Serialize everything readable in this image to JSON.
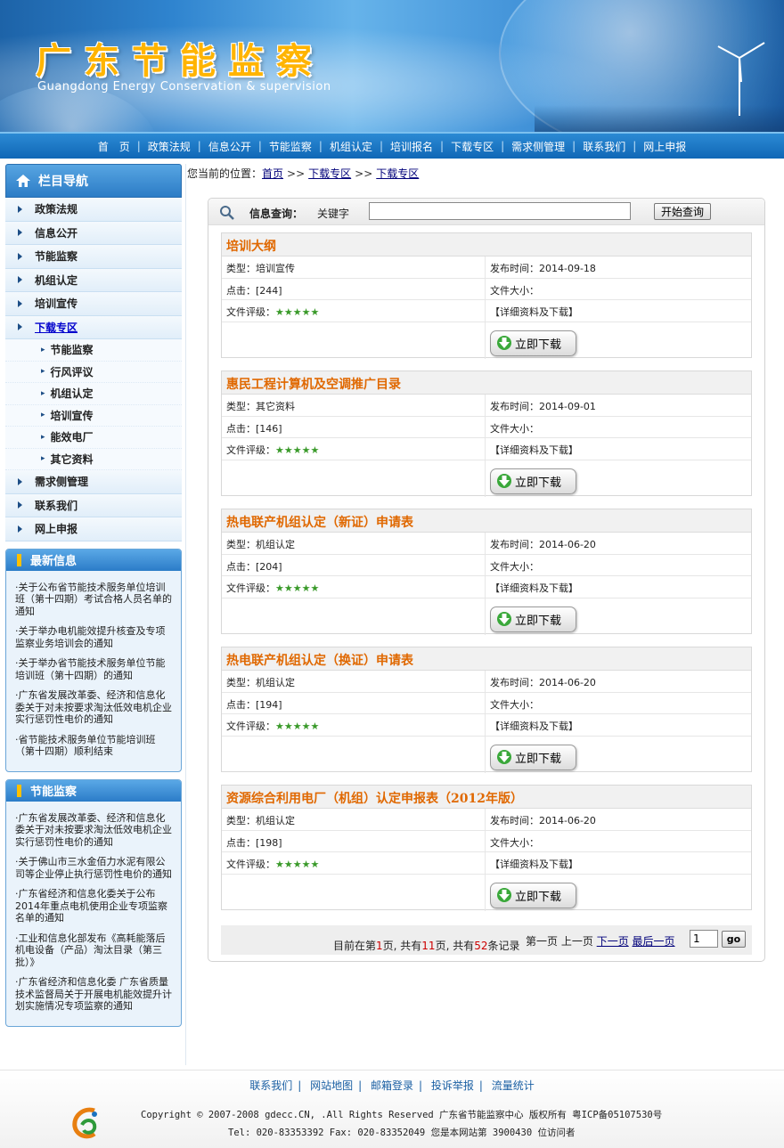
{
  "header": {
    "site_title": "广东节能监察",
    "site_subtitle": "Guangdong Energy Conservation & supervision"
  },
  "nav": [
    {
      "label": "首　页"
    },
    {
      "label": "政策法规"
    },
    {
      "label": "信息公开"
    },
    {
      "label": "节能监察"
    },
    {
      "label": "机组认定"
    },
    {
      "label": "培训报名"
    },
    {
      "label": "下载专区"
    },
    {
      "label": "需求侧管理"
    },
    {
      "label": "联系我们"
    },
    {
      "label": "网上申报"
    }
  ],
  "sidebar": {
    "title": "栏目导航",
    "items": [
      {
        "label": "政策法规"
      },
      {
        "label": "信息公开"
      },
      {
        "label": "节能监察"
      },
      {
        "label": "机组认定"
      },
      {
        "label": "培训宣传"
      },
      {
        "label": "下载专区"
      }
    ],
    "subitems": [
      {
        "label": "节能监察"
      },
      {
        "label": "行风评议"
      },
      {
        "label": "机组认定"
      },
      {
        "label": "培训宣传"
      },
      {
        "label": "能效电厂"
      },
      {
        "label": "其它资料"
      }
    ],
    "items_after": [
      {
        "label": "需求侧管理"
      },
      {
        "label": "联系我们"
      },
      {
        "label": "网上申报"
      }
    ]
  },
  "latest_news": {
    "title": "最新信息",
    "items": [
      "·关于公布省节能技术服务单位培训班（第十四期）考试合格人员名单的通知",
      "·关于举办电机能效提升核查及专项监察业务培训会的通知",
      "·关于举办省节能技术服务单位节能培训班（第十四期）的通知",
      "·广东省发展改革委、经济和信息化委关于对未按要求淘汰低效电机企业实行惩罚性电价的通知",
      "·省节能技术服务单位节能培训班（第十四期）顺利结束"
    ]
  },
  "supervision_news": {
    "title": "节能监察",
    "items": [
      "·广东省发展改革委、经济和信息化委关于对未按要求淘汰低效电机企业实行惩罚性电价的通知",
      "·关于佛山市三水金佰力水泥有限公司等企业停止执行惩罚性电价的通知",
      "·广东省经济和信息化委关于公布2014年重点电机使用企业专项监察名单的通知",
      "·工业和信息化部发布《高耗能落后机电设备（产品）淘汰目录（第三批）》",
      "·广东省经济和信息化委 广东省质量技术监督局关于开展电机能效提升计划实施情况专项监察的通知"
    ]
  },
  "breadcrumb": {
    "prefix": "您当前的位置：",
    "links": [
      "首页",
      "下载专区",
      "下载专区"
    ],
    "sep": ">>"
  },
  "search": {
    "label": "信息查询：",
    "keyword_label": "关键字",
    "value": "",
    "button": "开始查询"
  },
  "labels": {
    "type": "类型：",
    "hits": "点击：",
    "rating": "文件评级：",
    "date": "发布时间：",
    "size": "文件大小：",
    "detail": "【详细资料及下载】",
    "download": "立即下载"
  },
  "files": [
    {
      "title": "培训大纲",
      "type": "培训宣传",
      "hits": "[244]",
      "date": "2014-09-18",
      "stars": "★★★★★",
      "rating": 5
    },
    {
      "title": "惠民工程计算机及空调推广目录",
      "type": "其它资料",
      "hits": "[146]",
      "date": "2014-09-01",
      "stars": "★★★★★",
      "rating": 5
    },
    {
      "title": "热电联产机组认定（新证）申请表",
      "type": "机组认定",
      "hits": "[204]",
      "date": "2014-06-20",
      "stars": "★★★★★",
      "rating": 5
    },
    {
      "title": "热电联产机组认定（换证）申请表",
      "type": "机组认定",
      "hits": "[194]",
      "date": "2014-06-20",
      "stars": "★★★★★",
      "rating": 5
    },
    {
      "title": "资源综合利用电厂（机组）认定申报表（2012年版）",
      "type": "机组认定",
      "hits": "[198]",
      "date": "2014-06-20",
      "stars": "★★★★★",
      "rating": 5
    }
  ],
  "pager": {
    "t1": "目前在第",
    "current": "1",
    "t2": "页, 共有",
    "total_pages": "11",
    "t3": "页, 共有",
    "total_records": "52",
    "t4": "条记录",
    "first": "第一页",
    "prev": "上一页",
    "next": "下一页",
    "last": "最后一页",
    "input_value": "1",
    "go": "go"
  },
  "footer": {
    "links": [
      "联系我们",
      "网站地图",
      "邮箱登录",
      "投诉举报",
      "流量统计"
    ],
    "copyright": "Copyright © 2007-2008 gdecc.CN, .All Rights Reserved 广东省节能监察中心 版权所有 粤ICP备05107530号",
    "contact": "Tel: 020-83353392 Fax: 020-83352049 您是本网站第 3900430 位访问者"
  },
  "colors": {
    "nav_bg": "#1a72c0",
    "title_orange": "#e06800",
    "stars_green": "#3a9a2a",
    "link_blue": "#00007a"
  },
  "icons": [
    "search-icon",
    "home-icon",
    "download-arrow-icon",
    "wind-turbine-icon",
    "site-logo"
  ]
}
